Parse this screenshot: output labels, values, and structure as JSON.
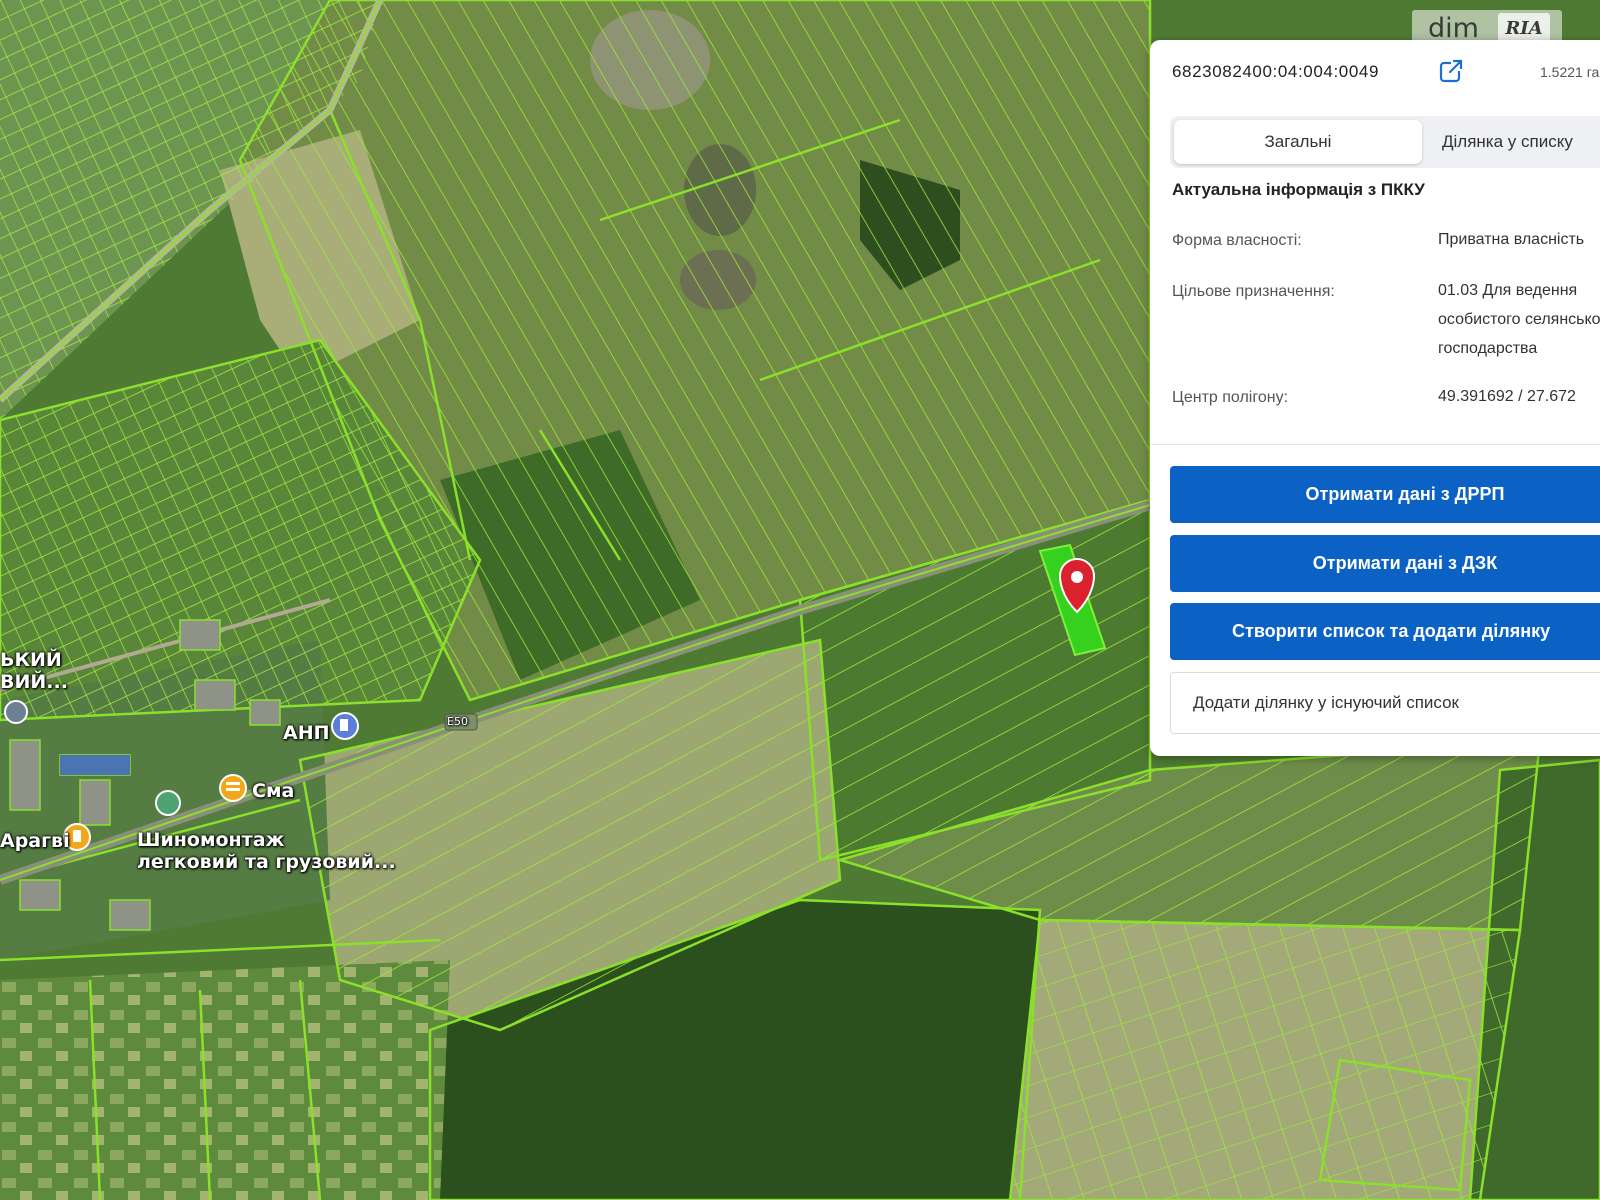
{
  "panel": {
    "cadastral_number": "6823082400:04:004:0049",
    "area": "1.5221 га",
    "tabs": [
      "Загальні",
      "Ділянка у списку"
    ],
    "section_title": "Актуальна інформація з ПККУ",
    "fields": [
      {
        "label": "Форма власності:",
        "value": [
          "Приватна власність"
        ]
      },
      {
        "label": "Цільове призначення:",
        "value": [
          "01.03 Для ведення",
          "особистого селянського",
          "господарства"
        ]
      },
      {
        "label": "Центр полігону:",
        "value": [
          "49.391692 / 27.672"
        ]
      }
    ],
    "buttons": {
      "drrp": "Отримати дані з ДРРП",
      "dzk": "Отримати дані з ДЗК",
      "create_list": "Створити список та додати ділянку",
      "add_existing": "Додати ділянку у існуючий список"
    }
  },
  "map": {
    "labels": {
      "road": "E50",
      "anp": "АНП",
      "sma": "Сма",
      "arahvi": "Арагві",
      "tire1": "Шиномонтаж",
      "tire2": "легковий та грузовий...",
      "vil1": "ЬКИЙ",
      "vil2": "ВИЙ..."
    },
    "parcel_color": "#8be02a",
    "selected_color": "#36d11f",
    "marker_color": "#d9222d"
  },
  "watermark": {
    "dim": "dim",
    "ria": "RIA"
  }
}
